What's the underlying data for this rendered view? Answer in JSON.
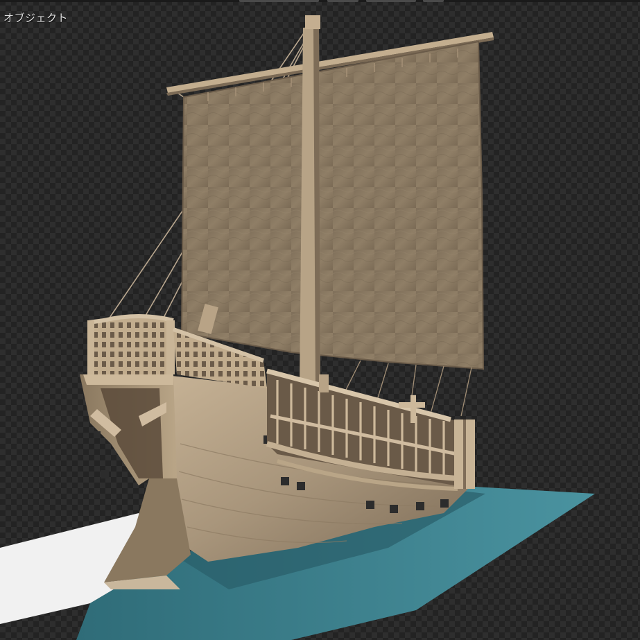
{
  "viewport": {
    "label": "オブジェクト"
  },
  "colors": {
    "background_dark": "#232323",
    "background_light": "#2e2e2e",
    "sail": "#8c7a62",
    "wood": "#b8a58c",
    "wood_shadow": "#6f5f4c",
    "water": "#3f8591",
    "ground": "#f2f2f2"
  },
  "icons": {
    "scene_object": "ship-object"
  }
}
